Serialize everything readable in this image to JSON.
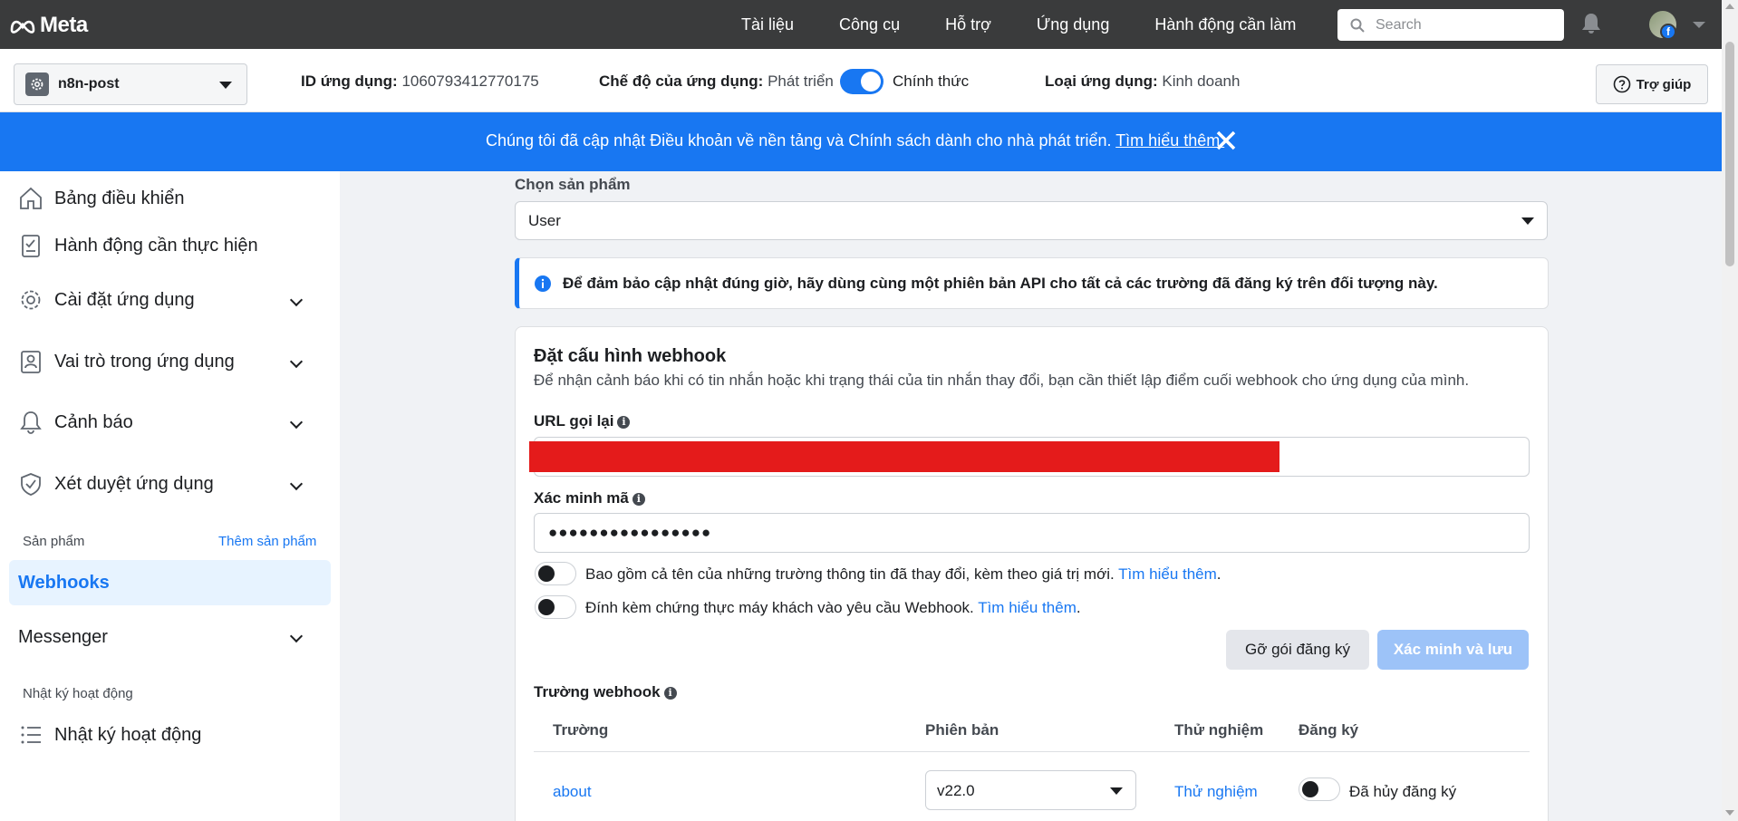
{
  "topnav": {
    "logo": "Meta",
    "links": [
      "Tài liệu",
      "Công cụ",
      "Hỗ trợ",
      "Ứng dụng",
      "Hành động cần làm"
    ],
    "search_placeholder": "Search"
  },
  "appbar": {
    "app_name": "n8n-post",
    "id_label": "ID ứng dụng:",
    "id_value": "1060793412770175",
    "mode_label": "Chế độ của ứng dụng:",
    "mode_dev": "Phát triển",
    "mode_live": "Chính thức",
    "type_label": "Loại ứng dụng:",
    "type_value": "Kinh doanh",
    "help": "Trợ giúp"
  },
  "banner": {
    "text": "Chúng tôi đã cập nhật Điều khoản về nền tảng và Chính sách dành cho nhà phát triển.",
    "link": "Tìm hiểu thêm."
  },
  "sidebar": {
    "items": [
      {
        "label": "Bảng điều khiển"
      },
      {
        "label": "Hành động cần thực hiện"
      },
      {
        "label": "Cài đặt ứng dụng"
      },
      {
        "label": "Vai trò trong ứng dụng"
      },
      {
        "label": "Cảnh báo"
      },
      {
        "label": "Xét duyệt ứng dụng"
      }
    ],
    "products_section": "Sản phẩm",
    "add_product": "Thêm sản phẩm",
    "active_product": "Webhooks",
    "messenger": "Messenger",
    "activity_section": "Nhật ký hoạt động",
    "activity_item": "Nhật ký hoạt động"
  },
  "main": {
    "product_label": "Chọn sản phẩm",
    "product_value": "User",
    "notice": "Để đảm bảo cập nhật đúng giờ, hãy dùng cùng một phiên bản API cho tất cả các trường đã đăng ký trên đối tượng này.",
    "card_title": "Đặt cấu hình webhook",
    "card_desc": "Để nhận cảnh báo khi có tin nhắn hoặc khi trạng thái của tin nhắn thay đổi, bạn cần thiết lập điểm cuối webhook cho ứng dụng của mình.",
    "callback_label": "URL gọi lại",
    "verify_label": "Xác minh mã",
    "verify_value": "●●●●●●●●●●●●●●●●",
    "opt1_text": "Bao gồm cả tên của những trường thông tin đã thay đổi, kèm theo giá trị mới.",
    "opt2_text": "Đính kèm chứng thực máy khách vào yêu cầu Webhook.",
    "learn_more": "Tìm hiểu thêm",
    "unsubscribe_btn": "Gỡ gói đăng ký",
    "verify_save_btn": "Xác minh và lưu",
    "fields_label": "Trường webhook",
    "table_headers": {
      "field": "Trường",
      "version": "Phiên bản",
      "test": "Thử nghiệm",
      "subscribe": "Đăng ký"
    },
    "rows": [
      {
        "field": "about",
        "version": "v22.0",
        "test": "Thử nghiệm",
        "status": "Đã hủy đăng ký"
      }
    ]
  }
}
